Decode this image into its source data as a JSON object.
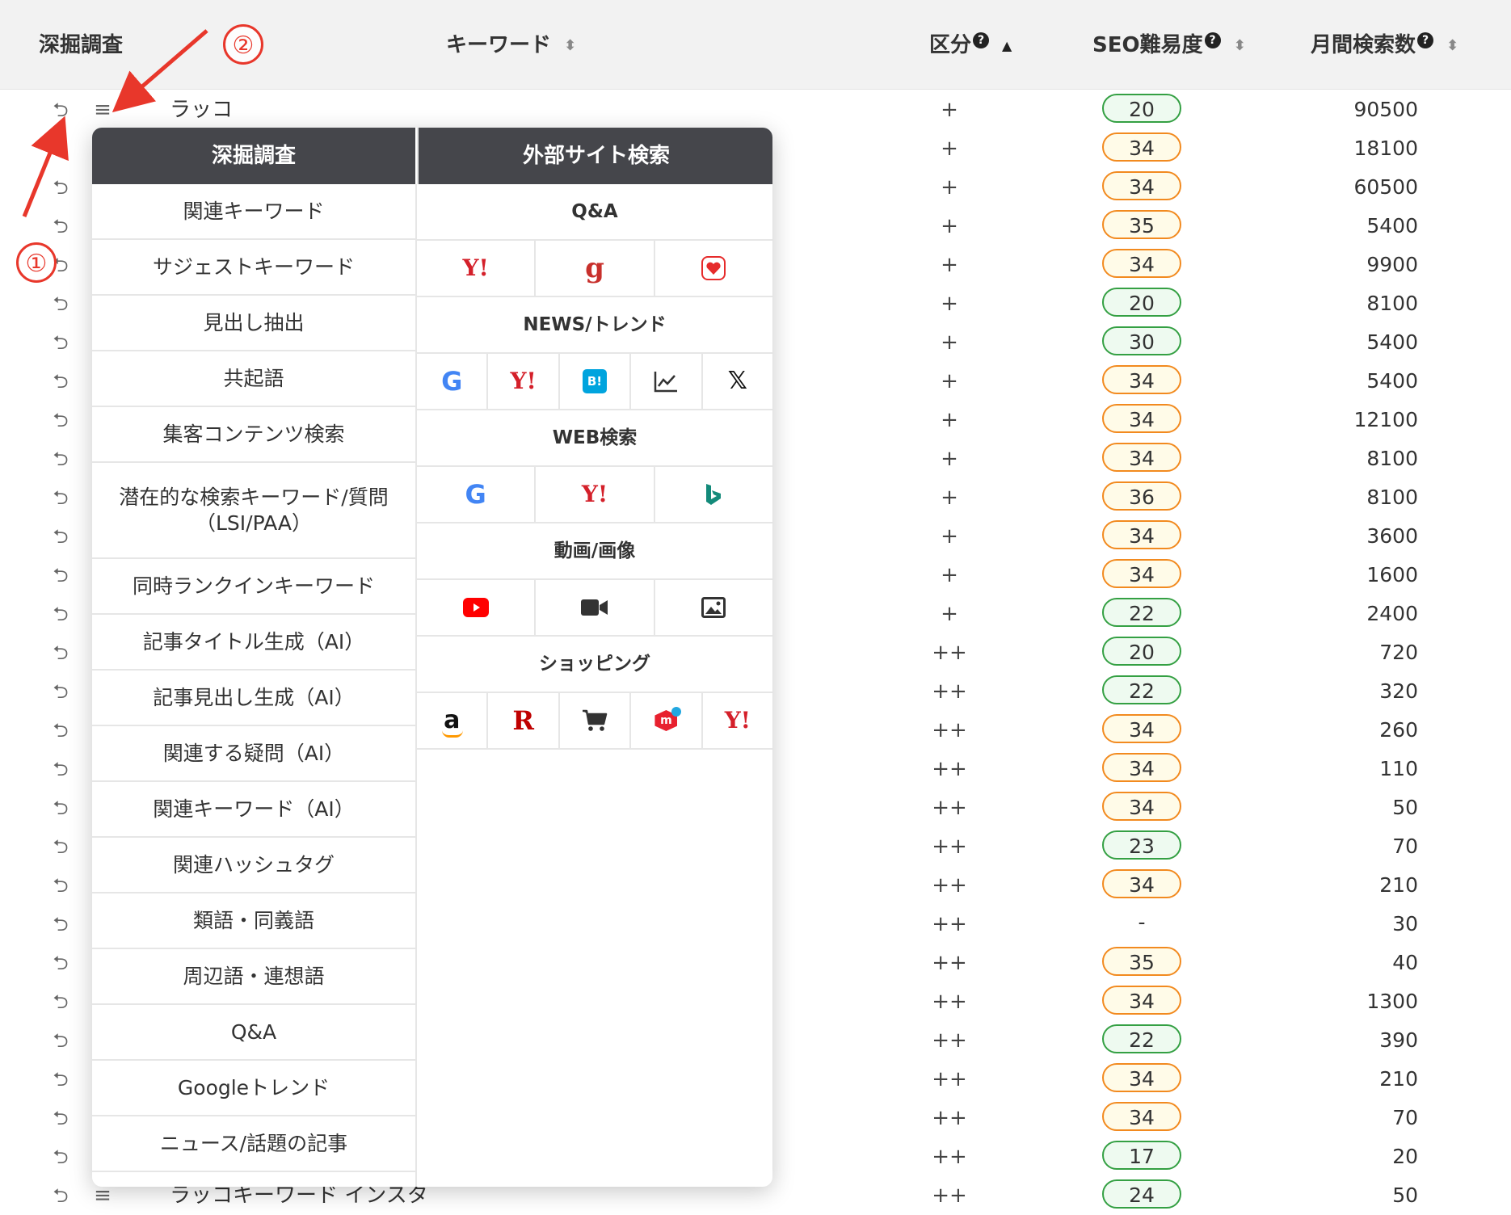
{
  "header": {
    "dig": "深掘調査",
    "keyword": "キーワード",
    "category": "区分",
    "seo": "SEO難易度",
    "volume": "月間検索数",
    "help_glyph": "?",
    "sort_glyph": "⬍",
    "sort_up_glyph": "▲"
  },
  "rows": [
    {
      "keyword": "ラッコ",
      "cat": "+",
      "seo": "20",
      "seo_color": "green",
      "vol": "90500"
    },
    {
      "keyword": "",
      "cat": "+",
      "seo": "34",
      "seo_color": "orange",
      "vol": "18100"
    },
    {
      "keyword": "",
      "cat": "+",
      "seo": "34",
      "seo_color": "orange",
      "vol": "60500"
    },
    {
      "keyword": "",
      "cat": "+",
      "seo": "35",
      "seo_color": "orange",
      "vol": "5400"
    },
    {
      "keyword": "",
      "cat": "+",
      "seo": "34",
      "seo_color": "orange",
      "vol": "9900"
    },
    {
      "keyword": "",
      "cat": "+",
      "seo": "20",
      "seo_color": "green",
      "vol": "8100"
    },
    {
      "keyword": "",
      "cat": "+",
      "seo": "30",
      "seo_color": "green",
      "vol": "5400"
    },
    {
      "keyword": "",
      "cat": "+",
      "seo": "34",
      "seo_color": "orange",
      "vol": "5400"
    },
    {
      "keyword": "",
      "cat": "+",
      "seo": "34",
      "seo_color": "orange",
      "vol": "12100"
    },
    {
      "keyword": "",
      "cat": "+",
      "seo": "34",
      "seo_color": "orange",
      "vol": "8100"
    },
    {
      "keyword": "",
      "cat": "+",
      "seo": "36",
      "seo_color": "orange",
      "vol": "8100"
    },
    {
      "keyword": "",
      "cat": "+",
      "seo": "34",
      "seo_color": "orange",
      "vol": "3600"
    },
    {
      "keyword": "",
      "cat": "+",
      "seo": "34",
      "seo_color": "orange",
      "vol": "1600"
    },
    {
      "keyword": "",
      "cat": "+",
      "seo": "22",
      "seo_color": "green",
      "vol": "2400"
    },
    {
      "keyword": "",
      "cat": "++",
      "seo": "20",
      "seo_color": "green",
      "vol": "720"
    },
    {
      "keyword": "",
      "cat": "++",
      "seo": "22",
      "seo_color": "green",
      "vol": "320"
    },
    {
      "keyword": "",
      "cat": "++",
      "seo": "34",
      "seo_color": "orange",
      "vol": "260"
    },
    {
      "keyword": "",
      "cat": "++",
      "seo": "34",
      "seo_color": "orange",
      "vol": "110"
    },
    {
      "keyword": "",
      "cat": "++",
      "seo": "34",
      "seo_color": "orange",
      "vol": "50"
    },
    {
      "keyword": "",
      "cat": "++",
      "seo": "23",
      "seo_color": "green",
      "vol": "70"
    },
    {
      "keyword": "",
      "cat": "++",
      "seo": "34",
      "seo_color": "orange",
      "vol": "210"
    },
    {
      "keyword": "",
      "cat": "++",
      "seo": "-",
      "seo_color": "none",
      "vol": "30"
    },
    {
      "keyword": "",
      "cat": "++",
      "seo": "35",
      "seo_color": "orange",
      "vol": "40"
    },
    {
      "keyword": "",
      "cat": "++",
      "seo": "34",
      "seo_color": "orange",
      "vol": "1300"
    },
    {
      "keyword": "",
      "cat": "++",
      "seo": "22",
      "seo_color": "green",
      "vol": "390"
    },
    {
      "keyword": "",
      "cat": "++",
      "seo": "34",
      "seo_color": "orange",
      "vol": "210"
    },
    {
      "keyword": "",
      "cat": "++",
      "seo": "34",
      "seo_color": "orange",
      "vol": "70"
    },
    {
      "keyword": "",
      "cat": "++",
      "seo": "17",
      "seo_color": "green",
      "vol": "20"
    },
    {
      "keyword": "ラッコキーワード インスタ",
      "cat": "++",
      "seo": "24",
      "seo_color": "green",
      "vol": "50"
    }
  ],
  "icons": {
    "dig": "⮌",
    "menu": "≡"
  },
  "dropdown": {
    "left_title": "深掘調査",
    "right_title": "外部サイト検索",
    "left_items": [
      "関連キーワード",
      "サジェストキーワード",
      "見出し抽出",
      "共起語",
      "集客コンテンツ検索",
      "潜在的な検索キーワード/質問（LSI/PAA）",
      "同時ランクインキーワード",
      "記事タイトル生成（AI）",
      "記事見出し生成（AI）",
      "関連する疑問（AI）",
      "関連キーワード（AI）",
      "関連ハッシュタグ",
      "類語・同義語",
      "周辺語・連想語",
      "Q&A",
      "Googleトレンド",
      "ニュース/話題の記事"
    ],
    "sections": {
      "qa": "Q&A",
      "news": "NEWS/トレンド",
      "web": "WEB検索",
      "video": "動画/画像",
      "shopping": "ショッピング"
    },
    "glyphs": {
      "yahoo": "Y!",
      "goo": "g",
      "google": "G",
      "hatena": "B!",
      "x": "𝕏",
      "amazon": "a",
      "rakuten": "R",
      "mercari": "m"
    }
  },
  "annotations": {
    "one": "①",
    "two": "②"
  },
  "colors": {
    "accent_red": "#e8372b",
    "seo_orange": "#f28a1f",
    "seo_green": "#34a043",
    "header_bg": "#f2f2f2",
    "dropdown_head": "#45464b"
  }
}
